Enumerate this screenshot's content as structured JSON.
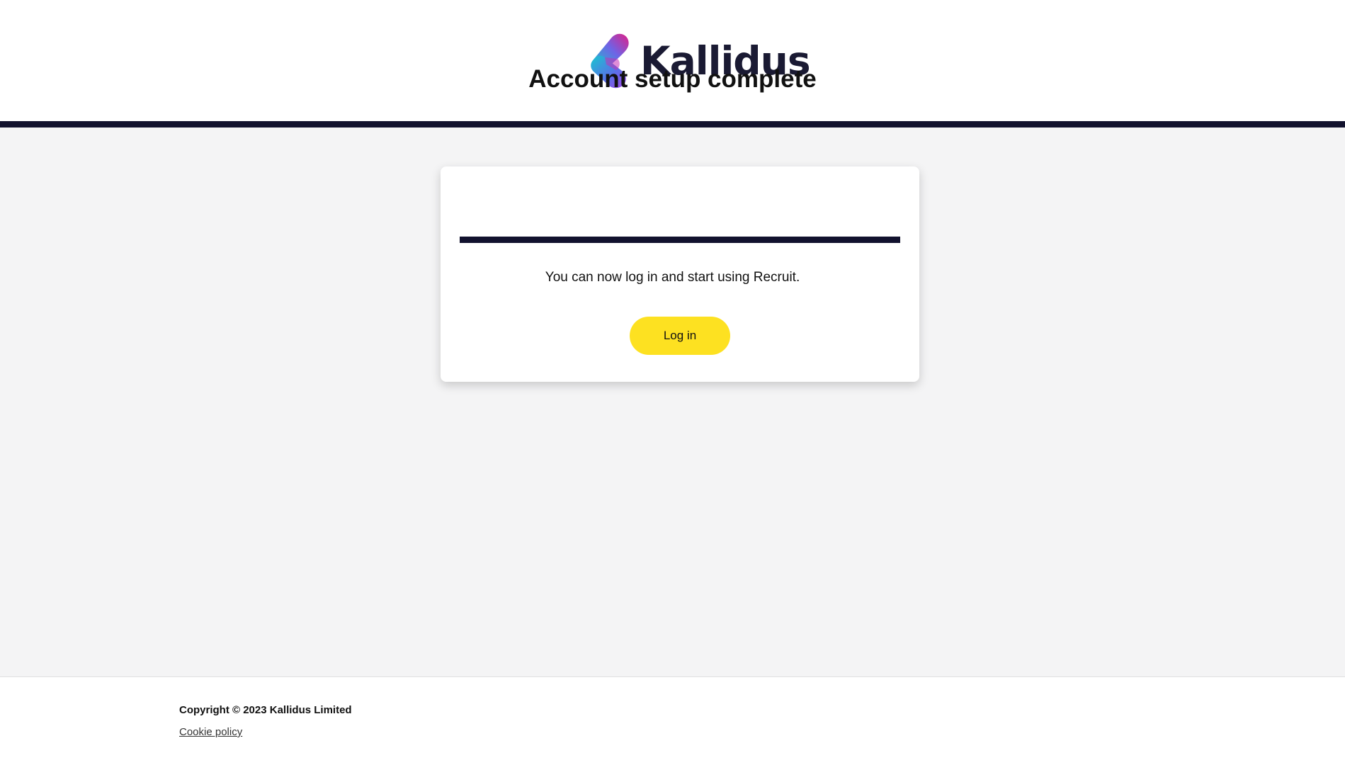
{
  "header": {
    "logo_text": "Kallidus",
    "logo_icon": "kallidus-logo-mark",
    "bar_color": "#12122e"
  },
  "card": {
    "title": "Account setup complete",
    "message": "You can now log in and start using Recruit.",
    "login_label": "Log in",
    "button_color": "#fde121"
  },
  "footer": {
    "copyright": "Copyright © 2023 Kallidus Limited",
    "cookie_link": "Cookie policy"
  }
}
